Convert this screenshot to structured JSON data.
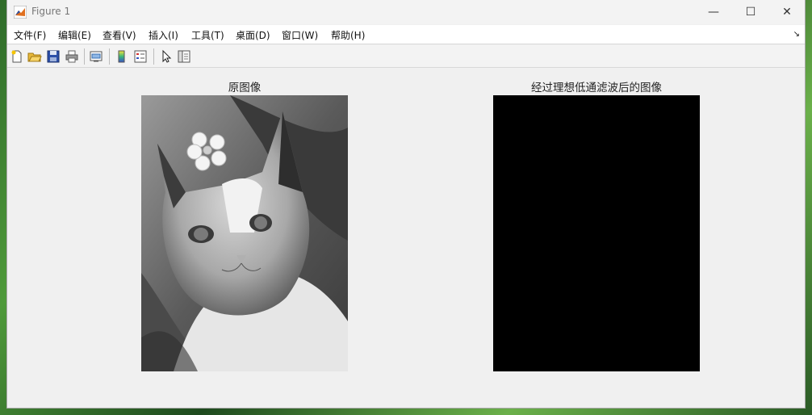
{
  "window": {
    "title": "Figure 1",
    "controls": {
      "minimize": "—",
      "maximize": "☐",
      "close": "✕"
    }
  },
  "menu": {
    "items": [
      "文件(F)",
      "编辑(E)",
      "查看(V)",
      "插入(I)",
      "工具(T)",
      "桌面(D)",
      "窗口(W)",
      "帮助(H)"
    ],
    "overflow": "↘"
  },
  "toolbar": {
    "buttons": [
      "new-figure-icon",
      "open-file-icon",
      "save-icon",
      "print-icon",
      "link-plot-icon",
      "colorbar-icon",
      "legend-icon",
      "pointer-icon",
      "property-editor-icon"
    ]
  },
  "figure": {
    "left_title": "原图像",
    "right_title": "经过理想低通滤波后的图像"
  },
  "colors": {
    "titlebar": "#f3f3f3",
    "menubar": "#ffffff",
    "figure_bg": "#f0f0f0",
    "filtered_image": "#000000"
  }
}
